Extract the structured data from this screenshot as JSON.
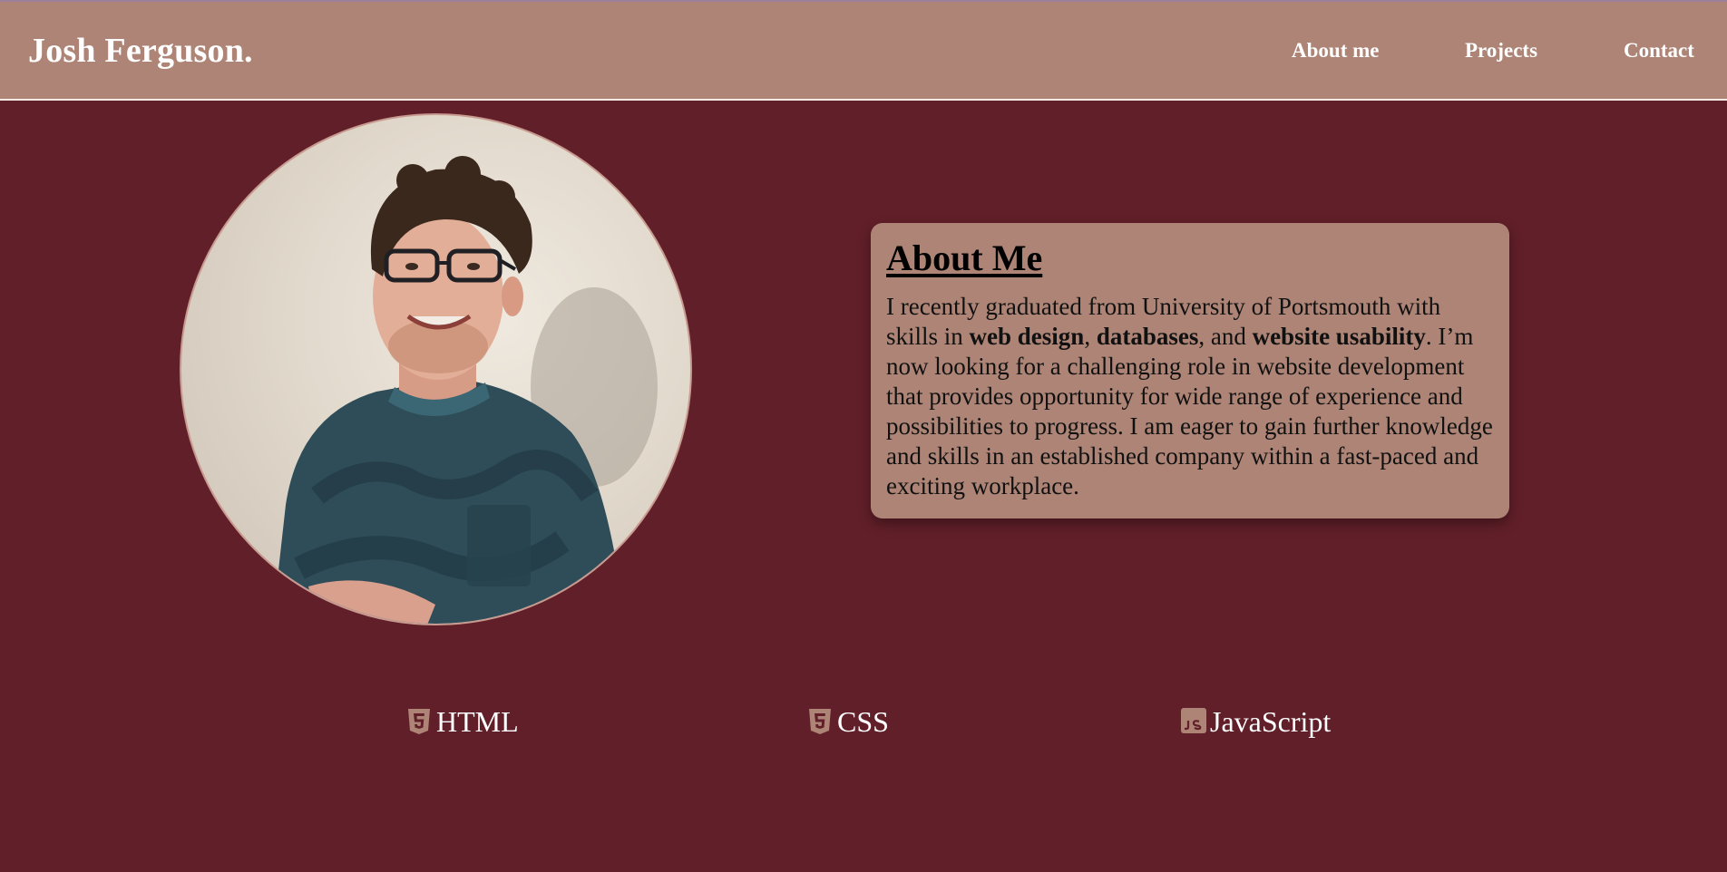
{
  "header": {
    "brand": "Josh Ferguson.",
    "nav": {
      "about": "About me",
      "projects": "Projects",
      "contact": "Contact"
    }
  },
  "about": {
    "title": "About Me",
    "text_1": "I recently graduated from University of Portsmouth with skills in ",
    "skill_1": "web design",
    "sep_1": ", ",
    "skill_2": "databases",
    "sep_2": ", and ",
    "skill_3": "website usability",
    "text_2": ". I’m now looking for a challenging role in website development that provides opportunity for wide range of experience and possibilities to progress. I am eager to gain further knowledge and skills in an established company within a fast-paced and exciting workplace."
  },
  "skills": [
    {
      "label": "HTML",
      "icon": "html5-icon"
    },
    {
      "label": "CSS",
      "icon": "css3-icon"
    },
    {
      "label": "JavaScript",
      "icon": "javascript-icon"
    }
  ],
  "colors": {
    "page_bg": "#611f29",
    "accent": "#ad8475",
    "text_light": "#ffffff"
  }
}
